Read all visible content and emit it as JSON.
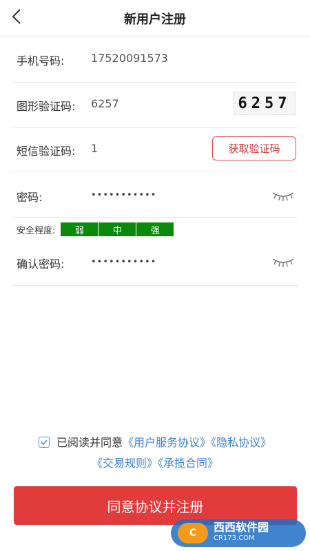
{
  "header": {
    "title": "新用户注册",
    "back_icon": "chevron-left-icon"
  },
  "form": {
    "phone": {
      "label": "手机号码:",
      "value": "17520091573"
    },
    "image_code": {
      "label": "图形验证码:",
      "value": "6257",
      "captcha_text": "6257"
    },
    "sms_code": {
      "label": "短信验证码:",
      "value": "1",
      "button": "获取验证码"
    },
    "password": {
      "label": "密码:",
      "value": "•••••••••••",
      "eye_icon": "eye-closed-icon"
    },
    "strength": {
      "label": "安全程度:",
      "levels": [
        "弱",
        "中",
        "强"
      ]
    },
    "confirm_password": {
      "label": "确认密码:",
      "value": "•••••••••••",
      "eye_icon": "eye-closed-icon"
    }
  },
  "agreement": {
    "checked": true,
    "prefix": "已阅读并同意",
    "links": [
      "《用户服务协议》",
      "《隐私协议》",
      "《交易规则》",
      "《承揽合同》"
    ]
  },
  "submit_label": "同意协议并注册",
  "watermark": {
    "logo_text": "C",
    "name": "西西软件园",
    "url": "CR173.COM"
  },
  "colors": {
    "accent": "#e23b3b",
    "link": "#3b82d6",
    "strength": "#0a8a0a"
  }
}
